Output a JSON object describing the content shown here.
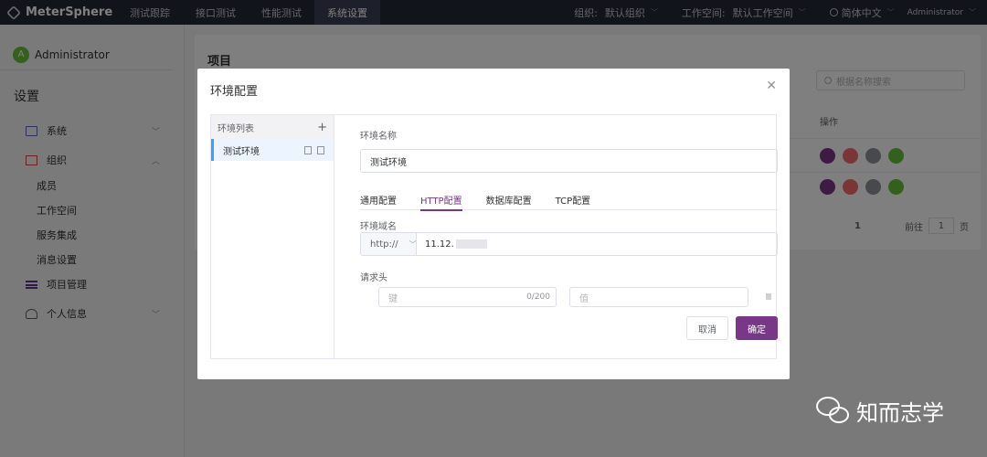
{
  "topbar": {
    "brand": "MeterSphere",
    "tabs": [
      "测试跟踪",
      "接口测试",
      "性能测试",
      "系统设置"
    ],
    "active_tab": "系统设置",
    "org_label": "组织:",
    "org_value": "默认组织",
    "workspace_label": "工作空间:",
    "workspace_value": "默认工作空间",
    "language": "简体中文",
    "user": "Administrator"
  },
  "sidebar": {
    "avatar_letter": "A",
    "user_name": "Administrator",
    "title": "设置",
    "system": "系统",
    "org": "组织",
    "org_items": [
      "成员",
      "工作空间",
      "服务集成",
      "消息设置"
    ],
    "project_mgmt": "项目管理",
    "personal": "个人信息"
  },
  "main": {
    "title": "项目",
    "search_placeholder": "根据名称搜索",
    "op_header": "操作",
    "page_current": "1",
    "goto_label": "前往",
    "goto_value": "1",
    "page_suffix": "页"
  },
  "dialog": {
    "title": "环境配置",
    "env_list_title": "环境列表",
    "env_item": "测试环境",
    "env_name_label": "环境名称",
    "env_name_value": "测试环境",
    "tabs": [
      "通用配置",
      "HTTP配置",
      "数据库配置",
      "TCP配置"
    ],
    "active_tab": "HTTP配置",
    "domain_label": "环境域名",
    "protocol": "http://",
    "domain_value": "11.12.",
    "headers_label": "请求头",
    "key_placeholder": "键",
    "key_counter": "0/200",
    "value_placeholder": "值",
    "cancel": "取消",
    "confirm": "确定"
  },
  "watermark": {
    "text": "知而志学"
  },
  "colors": {
    "accent": "#783887",
    "topbar": "#252838",
    "active_env": "#409eff"
  }
}
